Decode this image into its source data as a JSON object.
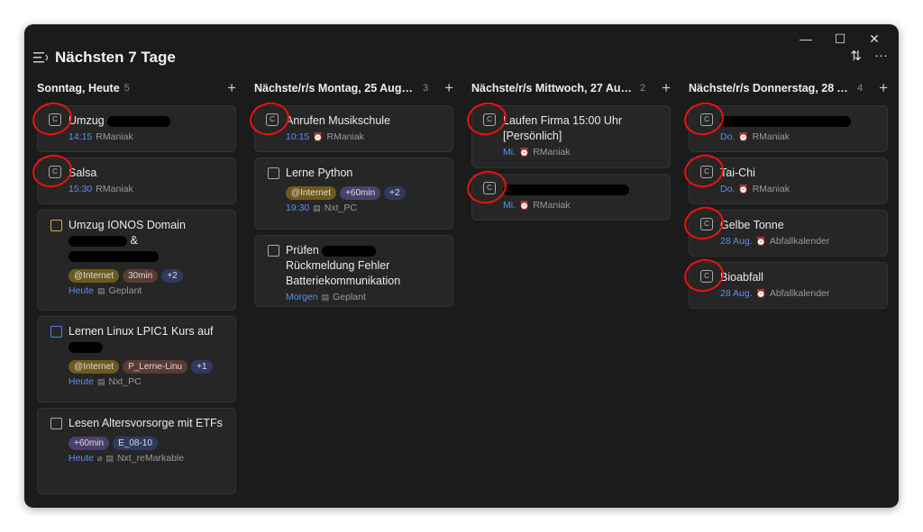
{
  "window": {
    "title": "Nächsten 7 Tage",
    "controls": [
      "—",
      "☐",
      "✕"
    ]
  },
  "toolbar": {
    "sort_icon": "sort-icon",
    "more_icon": "more-icon",
    "sort_glyph": "⇅",
    "more_glyph": "···"
  },
  "columns": [
    {
      "title": "Sonntag, Heute",
      "count": "5",
      "cards": [
        {
          "title": "Umzug",
          "date": "14:15",
          "meta": "RManiak"
        },
        {
          "title": "Salsa",
          "date": "15:30",
          "meta": "RManiak"
        },
        {
          "title": "Umzug IONOS Domain",
          "title2": "&",
          "tags": [
            "@Internet",
            "30min",
            "+2"
          ],
          "date": "Heute",
          "meta": "Geplant"
        },
        {
          "title": "Lernen Linux LPIC1 Kurs auf",
          "tags": [
            "@Internet",
            "P_Lerne-Linu",
            "+1"
          ],
          "date": "Heute",
          "meta": "Nxt_PC"
        },
        {
          "title": "Lesen Altersvorsorge mit ETFs",
          "tags": [
            "+60min",
            "E_08-10"
          ],
          "date": "Heute",
          "meta": "Nxt_reMarkable"
        }
      ]
    },
    {
      "title": "Nächste/r/s Montag, 25 August",
      "count": "3",
      "cards": [
        {
          "title": "Anrufen Musikschule",
          "date": "10:15",
          "meta": "RManiak"
        },
        {
          "title": "Lerne Python",
          "tags": [
            "@Internet",
            "+60min",
            "+2"
          ],
          "date": "19:30",
          "meta": "Nxt_PC"
        },
        {
          "title": "Prüfen",
          "title2": "Rückmeldung Fehler Batteriekommunikation",
          "date": "Morgen",
          "meta": "Geplant"
        }
      ]
    },
    {
      "title": "Nächste/r/s Mittwoch, 27 Aug...",
      "count": "2",
      "cards": [
        {
          "title": "Laufen Firma 15:00 Uhr [Persönlich]",
          "date": "Mi.",
          "meta": "RManiak"
        },
        {
          "title": "",
          "date": "Mi.",
          "meta": "RManiak"
        }
      ]
    },
    {
      "title": "Nächste/r/s Donnerstag, 28 A...",
      "count": "4",
      "cards": [
        {
          "title": "",
          "date": "Do.",
          "meta": "RManiak"
        },
        {
          "title": "Tai-Chi",
          "date": "Do.",
          "meta": "RManiak"
        },
        {
          "title": "Gelbe Tonne",
          "date": "28 Aug.",
          "meta": "Abfallkalender"
        },
        {
          "title": "Bioabfall",
          "date": "28 Aug.",
          "meta": "Abfallkalender"
        }
      ]
    }
  ],
  "colors": {
    "accent_date": "#5b8ef0",
    "annotation": "#e11111",
    "tag_internet": "#6e5a1e",
    "tag_time": "#4b3f6b"
  }
}
